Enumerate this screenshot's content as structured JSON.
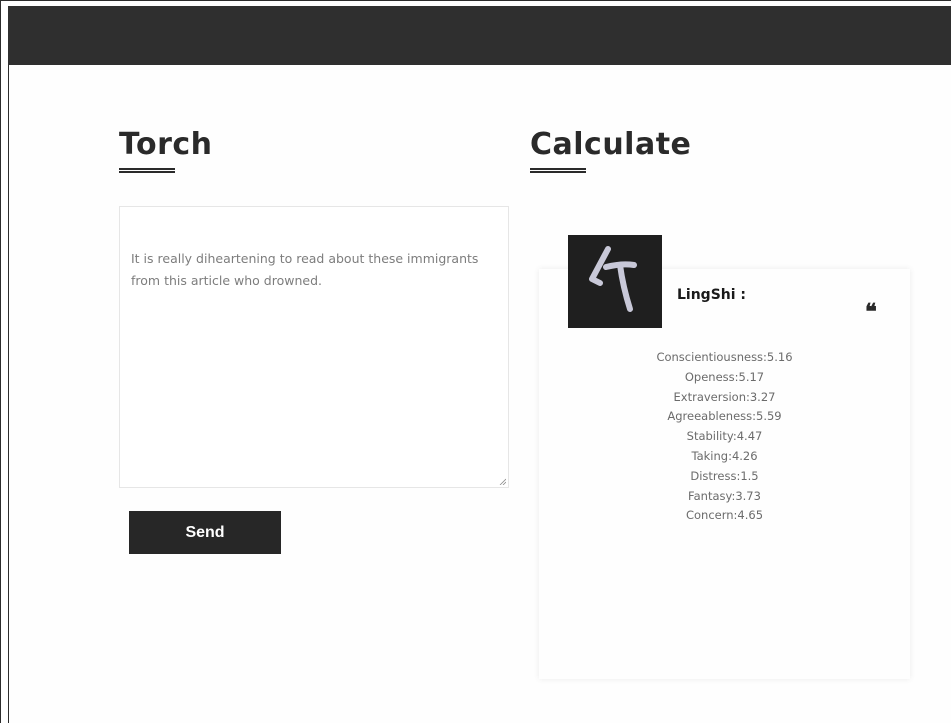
{
  "left_panel": {
    "title": "Torch",
    "textarea_value": "It is really diheartening to read about these immigrants from this article who drowned.",
    "send_label": "Send"
  },
  "right_panel": {
    "title": "Calculate",
    "card": {
      "name": "LingShi :",
      "avatar_icon": "ling-shi-logo-icon",
      "quote_icon": "quote-icon",
      "metrics": [
        "Conscientiousness:5.16",
        "Openess:5.17",
        "Extraversion:3.27",
        "Agreeableness:5.59",
        "Stability:4.47",
        "Taking:4.26",
        "Distress:1.5",
        "Fantasy:3.73",
        "Concern:4.65"
      ]
    }
  },
  "colors": {
    "topbar": "#2f2f2f",
    "button": "#272727",
    "heading": "#2a2a2a"
  }
}
